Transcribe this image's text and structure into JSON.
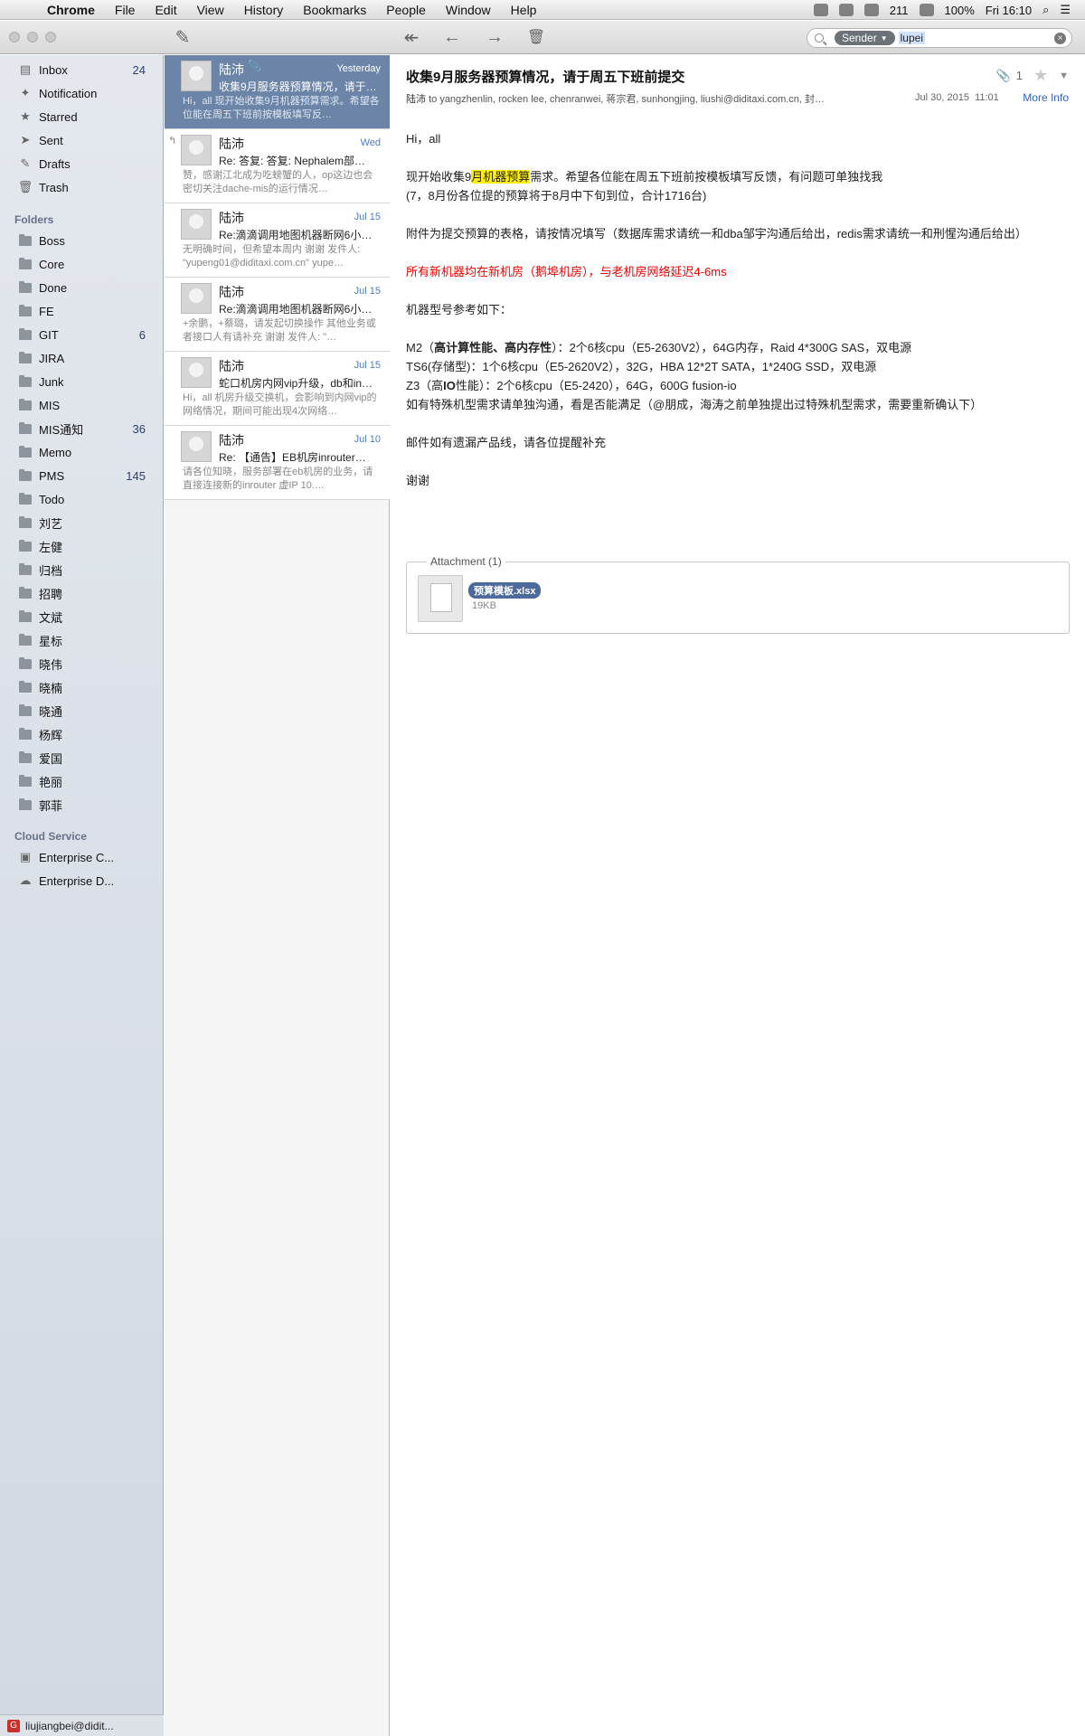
{
  "menubar": {
    "app_name": "Chrome",
    "items": [
      "File",
      "Edit",
      "View",
      "History",
      "Bookmarks",
      "People",
      "Window",
      "Help"
    ],
    "status": {
      "badge": "211",
      "battery": "100%",
      "clock": "Fri 16:10"
    }
  },
  "search": {
    "token": "Sender",
    "value": "lupei"
  },
  "sidebar": {
    "mailboxes": [
      {
        "label": "Inbox",
        "count": "24",
        "icon": "inbox-icon"
      },
      {
        "label": "Notification",
        "count": "",
        "icon": "pin-icon"
      },
      {
        "label": "Starred",
        "count": "",
        "icon": "star-icon"
      },
      {
        "label": "Sent",
        "count": "",
        "icon": "sent-icon"
      },
      {
        "label": "Drafts",
        "count": "",
        "icon": "drafts-icon"
      },
      {
        "label": "Trash",
        "count": "",
        "icon": "trash-icon"
      }
    ],
    "folders_heading": "Folders",
    "folders": [
      {
        "label": "Boss",
        "count": ""
      },
      {
        "label": "Core",
        "count": ""
      },
      {
        "label": "Done",
        "count": ""
      },
      {
        "label": "FE",
        "count": ""
      },
      {
        "label": "GIT",
        "count": "6"
      },
      {
        "label": "JIRA",
        "count": ""
      },
      {
        "label": "Junk",
        "count": ""
      },
      {
        "label": "MIS",
        "count": ""
      },
      {
        "label": "MIS通知",
        "count": "36"
      },
      {
        "label": "Memo",
        "count": ""
      },
      {
        "label": "PMS",
        "count": "145"
      },
      {
        "label": "Todo",
        "count": ""
      },
      {
        "label": "刘艺",
        "count": ""
      },
      {
        "label": "左健",
        "count": ""
      },
      {
        "label": "归档",
        "count": ""
      },
      {
        "label": "招聘",
        "count": ""
      },
      {
        "label": "文斌",
        "count": ""
      },
      {
        "label": "星标",
        "count": ""
      },
      {
        "label": "晓伟",
        "count": ""
      },
      {
        "label": "晓楠",
        "count": ""
      },
      {
        "label": "晓通",
        "count": ""
      },
      {
        "label": "杨辉",
        "count": ""
      },
      {
        "label": "爱国",
        "count": ""
      },
      {
        "label": "艳丽",
        "count": ""
      },
      {
        "label": "郭菲",
        "count": ""
      }
    ],
    "cloud_heading": "Cloud Service",
    "cloud": [
      {
        "label": "Enterprise C..."
      },
      {
        "label": "Enterprise D..."
      }
    ],
    "account": "liujiangbei@didit..."
  },
  "messages": [
    {
      "sender": "陆沛",
      "date": "Yesterday",
      "subject": "收集9月服务器预算情况，请于…",
      "preview": "Hi，all 现开始收集9月机器预算需求。希望各位能在周五下班前按模板填写反…",
      "selected": true,
      "attachment": true,
      "replied": false
    },
    {
      "sender": "陆沛",
      "date": "Wed",
      "subject": "Re: 答复: 答复: Nephalem部…",
      "preview": "赞，感谢江北成为吃螃蟹的人，op这边也会密切关注dache-mis的运行情况…",
      "selected": false,
      "attachment": false,
      "replied": true
    },
    {
      "sender": "陆沛",
      "date": "Jul 15",
      "subject": "Re:滴滴调用地图机器断网6小…",
      "preview": "无明确时间，但希望本周内 谢谢 发件人: \"yupeng01@diditaxi.com.cn\" yupe…",
      "selected": false,
      "attachment": false,
      "replied": false
    },
    {
      "sender": "陆沛",
      "date": "Jul 15",
      "subject": "Re:滴滴调用地图机器断网6小…",
      "preview": "+余鹏，+蔡璐，请发起切换操作 其他业务或者接口人有请补充 谢谢 发件人: \"…",
      "selected": false,
      "attachment": false,
      "replied": false
    },
    {
      "sender": "陆沛",
      "date": "Jul 15",
      "subject": "蛇口机房内网vip升级，db和in…",
      "preview": "Hi，all 机房升级交换机，会影响到内网vip的网络情况，期间可能出现4次网络…",
      "selected": false,
      "attachment": false,
      "replied": false
    },
    {
      "sender": "陆沛",
      "date": "Jul 10",
      "subject": "Re: 【通告】EB机房inrouter…",
      "preview": "请各位知晓，服务部署在eb机房的业务，请直接连接新的inrouter 虚IP 10.…",
      "selected": false,
      "attachment": false,
      "replied": false
    }
  ],
  "reader": {
    "subject": "收集9月服务器预算情况，请于周五下班前提交",
    "attachment_count": "1",
    "from": "陆沛",
    "to_word": "to",
    "recipients": "yangzhenlin, rocken lee, chenranwei, 蒋宗君, sunhongjing, liushi@diditaxi.com.cn, 封…",
    "date": "Jul 30, 2015",
    "time": "11:01",
    "more_info": "More Info",
    "body": {
      "greeting": "Hi，all",
      "p1_pre": "现开始收集9",
      "p1_hl": "月机器预算",
      "p1_post": "需求。希望各位能在周五下班前按模板填写反馈，有问题可单独找我",
      "p1_line2": "(7，8月份各位提的预算将于8月中下旬到位，合计1716台)",
      "p2": "附件为提交预算的表格，请按情况填写（数据库需求请统一和dba邹宇沟通后给出，redis需求请统一和刑惺沟通后给出）",
      "red_note": "所有新机器均在新机房（鹅埠机房），与老机房网络延迟4-6ms",
      "models_intro": "机器型号参考如下：",
      "m2_pre": "M2（",
      "m2_bold": "高计算性能、高内存性",
      "m2_post": "）：2个6核cpu（E5-2630V2），64G内存，Raid 4*300G SAS，双电源",
      "ts6": "TS6(存储型)：1个6核cpu（E5-2620V2），32G，HBA 12*2T SATA，1*240G SSD，双电源",
      "z3_pre": "Z3（高",
      "z3_bold": "IO",
      "z3_post": "性能）：2个6核cpu（E5-2420），64G，600G fusion-io",
      "special": "如有特殊机型需求请单独沟通，看是否能满足（@朋成，海涛之前单独提出过特殊机型需求，需要重新确认下）",
      "missing": "邮件如有遗漏产品线，请各位提醒补充",
      "thanks": "谢谢"
    },
    "attachment": {
      "legend": "Attachment (1)",
      "name": "预算模板.xlsx",
      "size": "19KB"
    }
  }
}
